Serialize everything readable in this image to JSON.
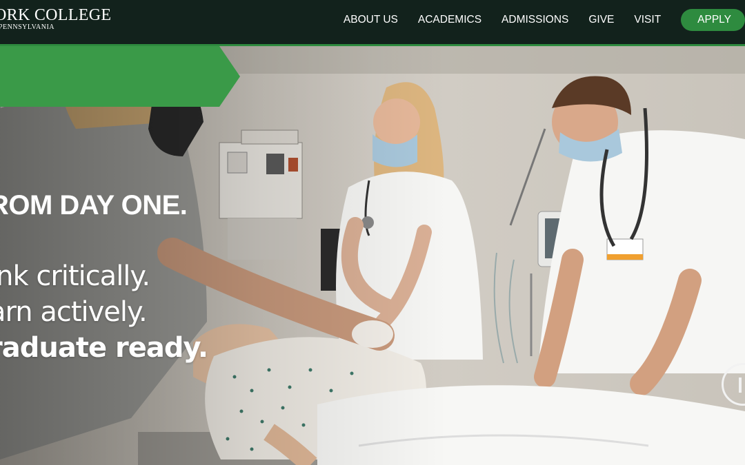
{
  "header": {
    "logo_main": "ORK COLLEGE",
    "logo_sub": "PENNSYLVANIA",
    "nav": [
      "ABOUT US",
      "ACADEMICS",
      "ADMISSIONS",
      "GIVE",
      "VISIT"
    ],
    "apply_label": "APPLY"
  },
  "hero": {
    "banner": "ROM DAY ONE.",
    "tagline_1": "ink critically.",
    "tagline_2": "arn actively.",
    "tagline_3": "raduate ready."
  },
  "colors": {
    "header_bg": "#12221c",
    "accent_green": "#2e8b3f",
    "banner_green": "#3a9a48"
  },
  "icons": {
    "play_pause": "pause-icon"
  }
}
